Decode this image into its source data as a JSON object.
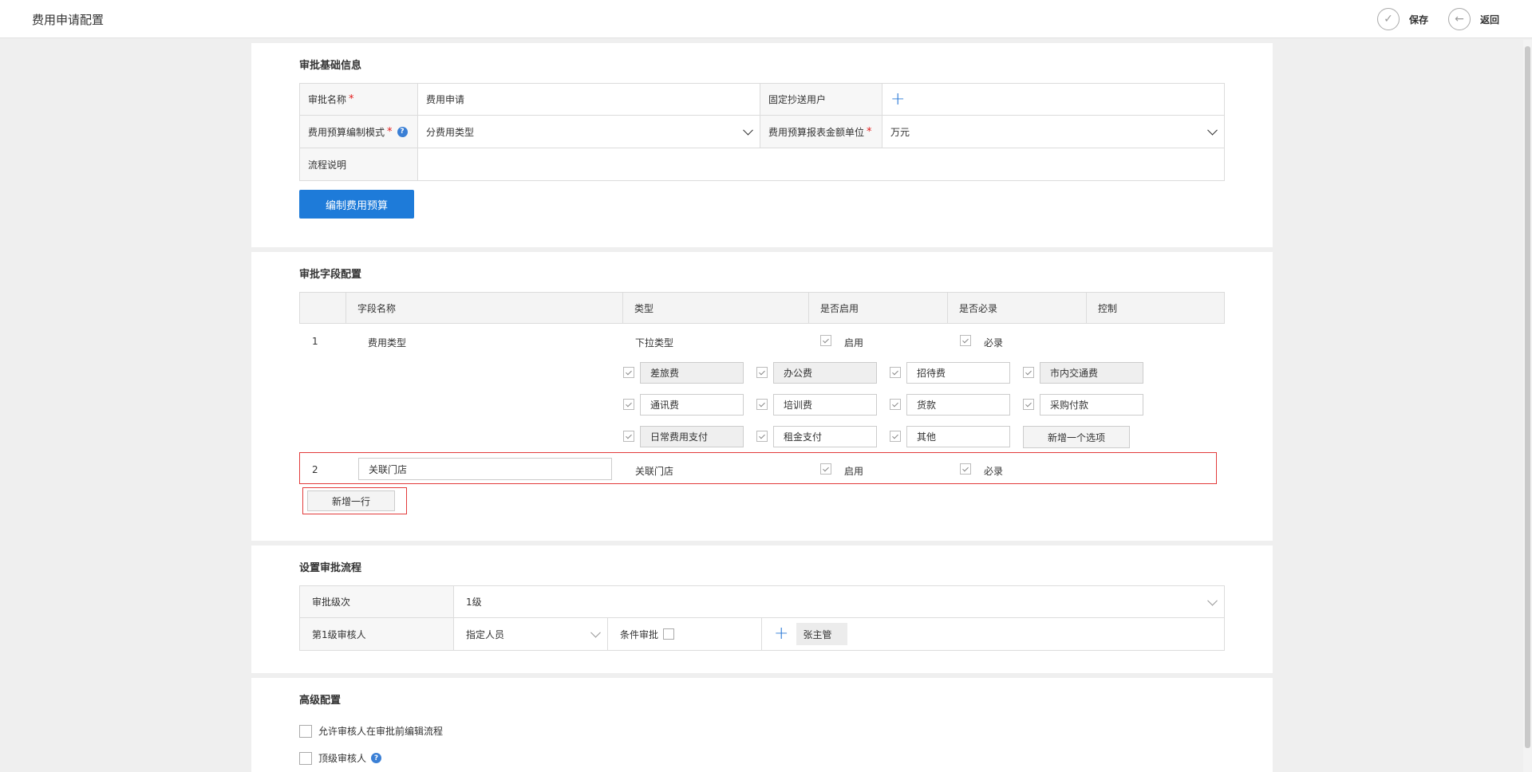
{
  "header": {
    "title": "费用申请配置",
    "save_label": "保存",
    "back_label": "返回"
  },
  "basic_info": {
    "section_title": "审批基础信息",
    "approval_name_label": "审批名称",
    "approval_name_value": "费用申请",
    "cc_users_label": "固定抄送用户",
    "budget_mode_label": "费用预算编制模式",
    "budget_mode_value": "分费用类型",
    "amount_unit_label": "费用预算报表金额单位",
    "amount_unit_value": "万元",
    "process_desc_label": "流程说明",
    "process_desc_value": "",
    "edit_budget_button": "编制费用预算"
  },
  "fields": {
    "section_title": "审批字段配置",
    "columns": [
      "",
      "字段名称",
      "类型",
      "是否启用",
      "是否必录",
      "控制"
    ],
    "rows": [
      {
        "index": "1",
        "name": "费用类型",
        "type": "下拉类型",
        "enabled_label": "启用",
        "required_label": "必录"
      },
      {
        "index": "2",
        "name": "关联门店",
        "type": "关联门店",
        "enabled_label": "启用",
        "required_label": "必录"
      }
    ],
    "options": [
      "差旅费",
      "办公费",
      "招待费",
      "市内交通费",
      "通讯费",
      "培训费",
      "货款",
      "采购付款",
      "日常费用支付",
      "租金支付",
      "其他"
    ],
    "add_option_button": "新增一个选项",
    "add_row_button": "新增一行"
  },
  "flow": {
    "section_title": "设置审批流程",
    "level_label": "审批级次",
    "level_value": "1级",
    "approver_label": "第1级审核人",
    "approver_type": "指定人员",
    "condition_label": "条件审批",
    "approver_tag": "张主管"
  },
  "advanced": {
    "section_title": "高级配置",
    "option1": "允许审核人在审批前编辑流程",
    "option2": "顶级审核人"
  },
  "colors": {
    "accent": "#1e7bd9",
    "required": "#e21b1b",
    "highlight_border": "#e23b3b"
  }
}
